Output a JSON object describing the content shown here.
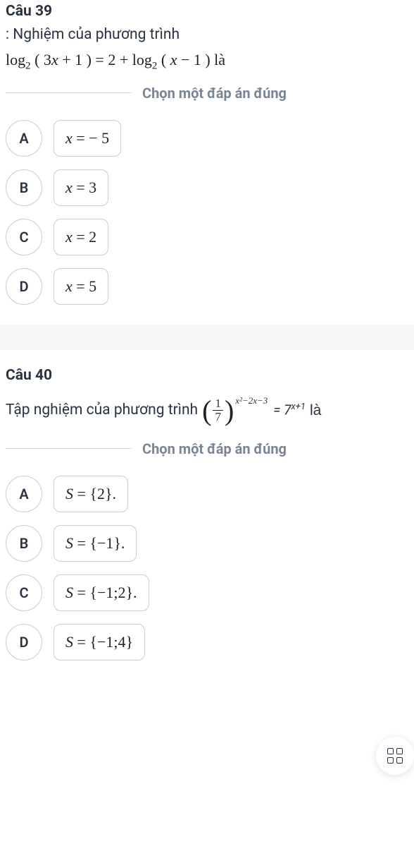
{
  "q39": {
    "title": "Câu 39",
    "prompt": ": Nghiệm của phương trình",
    "equation": "log₂ ( 3x + 1 ) = 2 + log₂ ( x − 1 ) là",
    "instruction": "Chọn một đáp án đúng",
    "options": [
      {
        "letter": "A",
        "content": "x = − 5"
      },
      {
        "letter": "B",
        "content": "x = 3"
      },
      {
        "letter": "C",
        "content": "x = 2"
      },
      {
        "letter": "D",
        "content": "x = 5"
      }
    ]
  },
  "q40": {
    "title": "Câu 40",
    "prompt_prefix": "Tập nghiệm của phương trình ",
    "frac_num": "1",
    "frac_den": "7",
    "exponent": "x²−2x−3",
    "rhs_base": "= 7",
    "rhs_exp": "x+1",
    "prompt_suffix": " là",
    "instruction": "Chọn một đáp án đúng",
    "options": [
      {
        "letter": "A",
        "content": "S = {2}."
      },
      {
        "letter": "B",
        "content": "S = {−1}."
      },
      {
        "letter": "C",
        "content": "S = {−1;2}."
      },
      {
        "letter": "D",
        "content": "S = {−1;4}"
      }
    ]
  }
}
